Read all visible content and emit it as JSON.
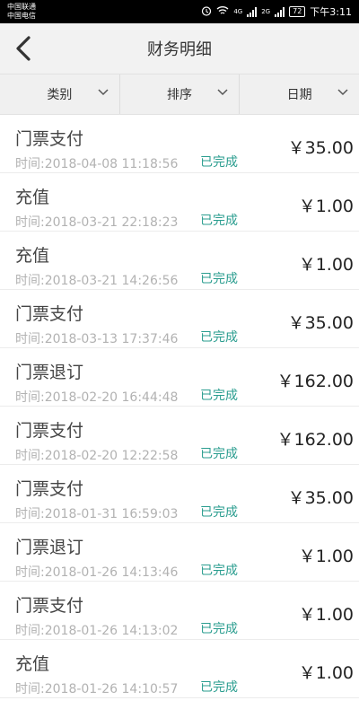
{
  "status_bar": {
    "carrier1": "中国联通",
    "carrier2": "中国电信",
    "net1": "4G",
    "net2": "2G",
    "battery": "72",
    "time": "下午3:11"
  },
  "header": {
    "title": "财务明细"
  },
  "filters": [
    {
      "label": "类别"
    },
    {
      "label": "排序"
    },
    {
      "label": "日期"
    }
  ],
  "records": [
    {
      "type": "门票支付",
      "time": "时间:2018-04-08 11:18:56",
      "status": "已完成",
      "amount": "￥35.00"
    },
    {
      "type": "充值",
      "time": "时间:2018-03-21 22:18:23",
      "status": "已完成",
      "amount": "￥1.00"
    },
    {
      "type": "充值",
      "time": "时间:2018-03-21 14:26:56",
      "status": "已完成",
      "amount": "￥1.00"
    },
    {
      "type": "门票支付",
      "time": "时间:2018-03-13 17:37:46",
      "status": "已完成",
      "amount": "￥35.00"
    },
    {
      "type": "门票退订",
      "time": "时间:2018-02-20 16:44:48",
      "status": "已完成",
      "amount": "￥162.00"
    },
    {
      "type": "门票支付",
      "time": "时间:2018-02-20 12:22:58",
      "status": "已完成",
      "amount": "￥162.00"
    },
    {
      "type": "门票支付",
      "time": "时间:2018-01-31 16:59:03",
      "status": "已完成",
      "amount": "￥35.00"
    },
    {
      "type": "门票退订",
      "time": "时间:2018-01-26 14:13:46",
      "status": "已完成",
      "amount": "￥1.00"
    },
    {
      "type": "门票支付",
      "time": "时间:2018-01-26 14:13:02",
      "status": "已完成",
      "amount": "￥1.00"
    },
    {
      "type": "充值",
      "time": "时间:2018-01-26 14:10:57",
      "status": "已完成",
      "amount": "￥1.00"
    }
  ],
  "colors": {
    "status_green": "#2a9d8f",
    "header_bg": "#f2f2f2"
  }
}
